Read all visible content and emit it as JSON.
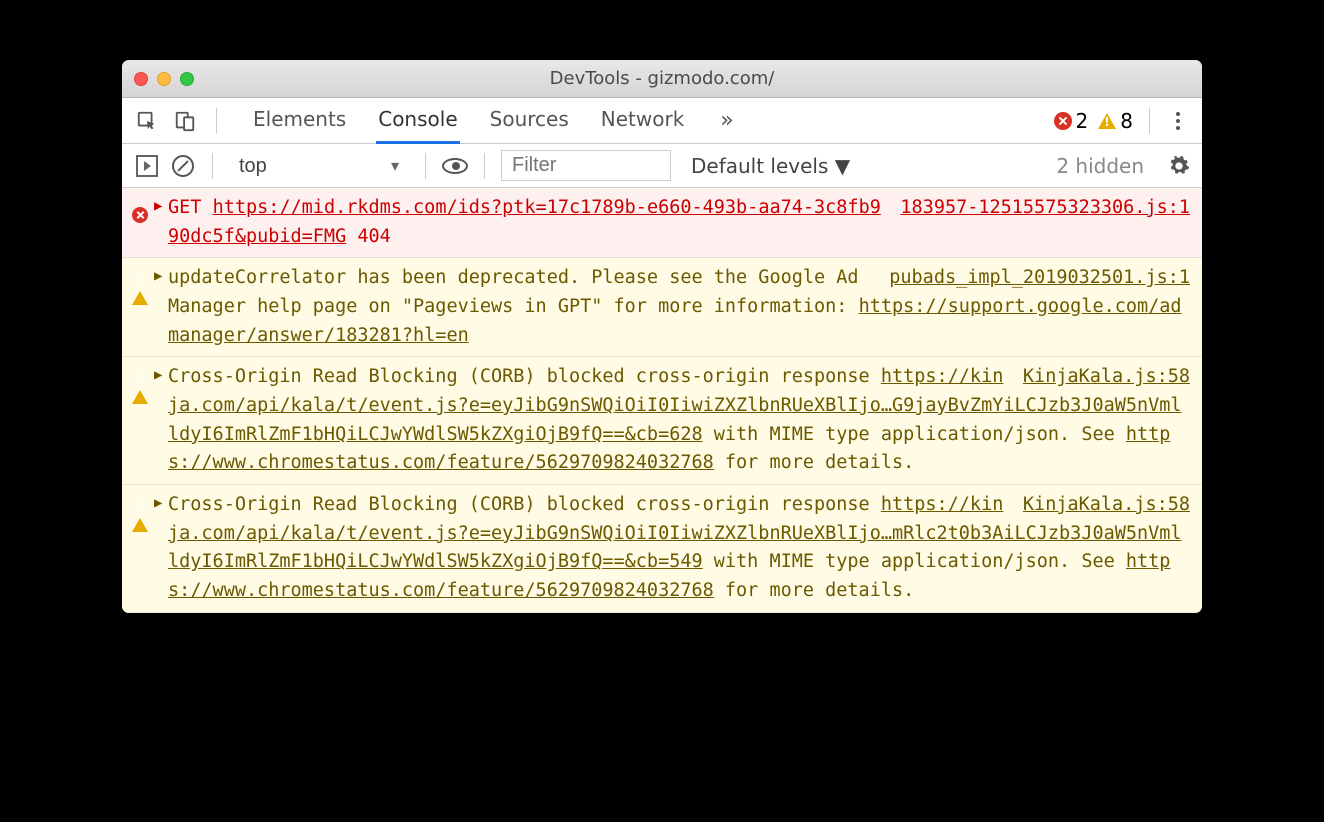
{
  "window": {
    "title": "DevTools - gizmodo.com/"
  },
  "tabs": {
    "items": [
      "Elements",
      "Console",
      "Sources",
      "Network"
    ],
    "active_index": 1
  },
  "counts": {
    "errors": "2",
    "warnings": "8"
  },
  "toolbar": {
    "context": "top",
    "filter_placeholder": "Filter",
    "level": "Default levels ▼",
    "hidden": "2 hidden"
  },
  "logs": [
    {
      "type": "error",
      "method": "GET",
      "url": "https://mid.rkdms.com/ids?ptk=17c1789b-e660-493b-aa74-3c8fb990dc5f&pubid=FMG",
      "status": "404",
      "source": "183957-12515575323306.js:1"
    },
    {
      "type": "warn",
      "text_pre": "updateCorrelator has been deprecated. Please see the Google Ad Manager help page on \"Pageviews in GPT\" for more information: ",
      "link": "https://support.google.com/admanager/answer/183281?hl=en",
      "source": "pubads_impl_2019032501.js:1"
    },
    {
      "type": "warn",
      "text_pre": "Cross-Origin Read Blocking (CORB) blocked cross-origin response ",
      "link": "https://kinja.com/api/kala/t/event.js?e=eyJibG9nSWQiOiI0IiwiZXZlbnRUeXBlIjo…G9jayBvZmYiLCJzb3J0aW5nVmlldyI6ImRlZmF1bHQiLCJwYWdlSW5kZXgiOjB9fQ==&cb=628",
      "text_mid": " with MIME type application/json. See ",
      "link2": "https://www.chromestatus.com/feature/5629709824032768",
      "text_post": " for more details.",
      "source": "KinjaKala.js:58"
    },
    {
      "type": "warn",
      "text_pre": "Cross-Origin Read Blocking (CORB) blocked cross-origin response ",
      "link": "https://kinja.com/api/kala/t/event.js?e=eyJibG9nSWQiOiI0IiwiZXZlbnRUeXBlIjo…mRlc2t0b3AiLCJzb3J0aW5nVmlldyI6ImRlZmF1bHQiLCJwYWdlSW5kZXgiOjB9fQ==&cb=549",
      "text_mid": " with MIME type application/json. See ",
      "link2": "https://www.chromestatus.com/feature/5629709824032768",
      "text_post": " for more details.",
      "source": "KinjaKala.js:58"
    }
  ]
}
